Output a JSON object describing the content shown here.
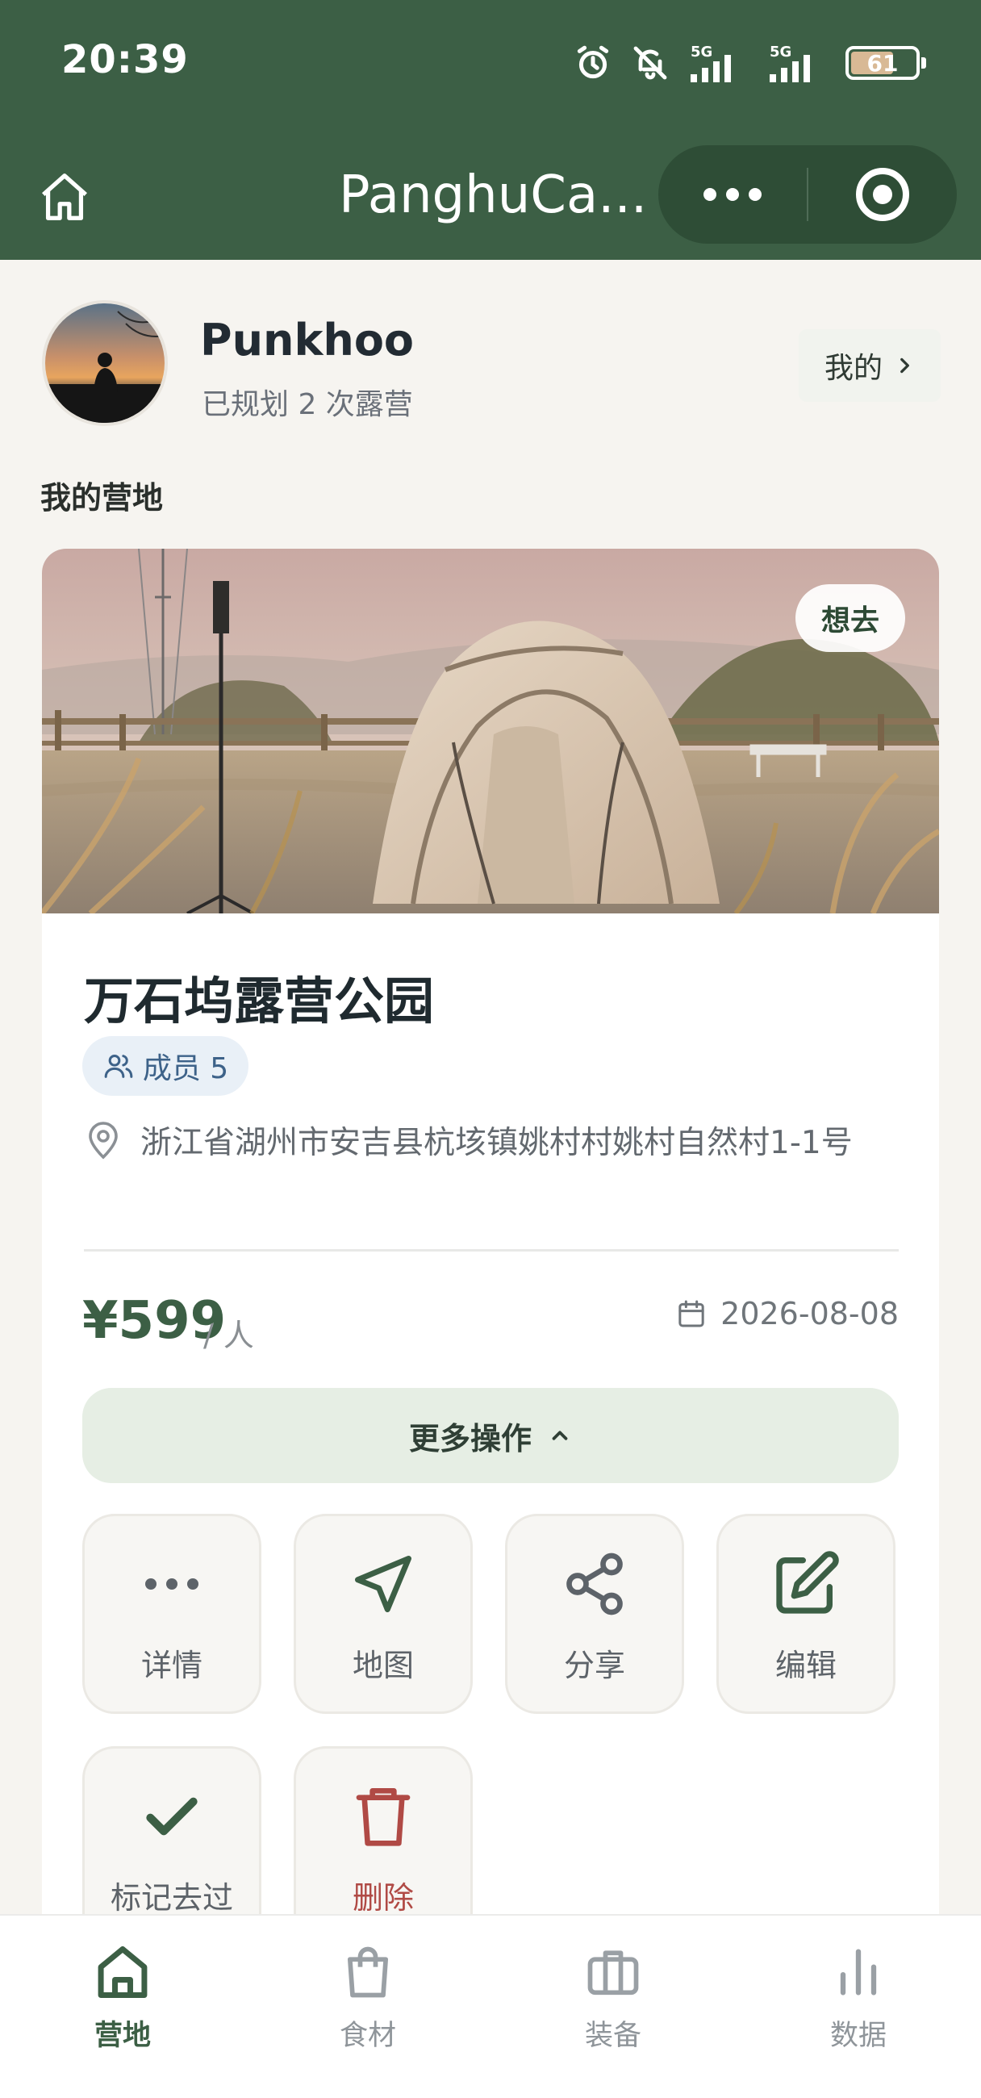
{
  "status_bar": {
    "time": "20:39",
    "battery": "61",
    "battery_level_pct": 61,
    "network_1": "5G",
    "network_2": "5G"
  },
  "header": {
    "title": "PanghuCa..."
  },
  "profile": {
    "name": "Punkhoo",
    "subtitle": "已规划 2 次露营",
    "mine_link": "我的"
  },
  "section_title": "我的营地",
  "campsite": {
    "badge": "想去",
    "name": "万石坞露营公园",
    "members": "成员 5",
    "address": "浙江省湖州市安吉县杭垓镇姚村村姚村自然村1-1号",
    "price": "¥599",
    "price_unit": "/ 人",
    "date": "2026-08-08",
    "more_actions": "更多操作"
  },
  "actions": [
    {
      "label": "详情",
      "icon": "more-dots-icon"
    },
    {
      "label": "地图",
      "icon": "navigation-arrow-icon"
    },
    {
      "label": "分享",
      "icon": "share-icon"
    },
    {
      "label": "编辑",
      "icon": "edit-icon"
    },
    {
      "label": "标记去过",
      "icon": "check-icon"
    },
    {
      "label": "删除",
      "icon": "trash-icon"
    }
  ],
  "tabs": [
    {
      "label": "营地",
      "icon": "home-icon",
      "active": true
    },
    {
      "label": "食材",
      "icon": "shopping-bag-icon",
      "active": false
    },
    {
      "label": "装备",
      "icon": "briefcase-icon",
      "active": false
    },
    {
      "label": "数据",
      "icon": "bar-chart-icon",
      "active": false
    }
  ],
  "colors": {
    "brand": "#3c5f45",
    "danger": "#b04a45",
    "background": "#f6f4f0",
    "member_pill": "#e9f0f7"
  }
}
